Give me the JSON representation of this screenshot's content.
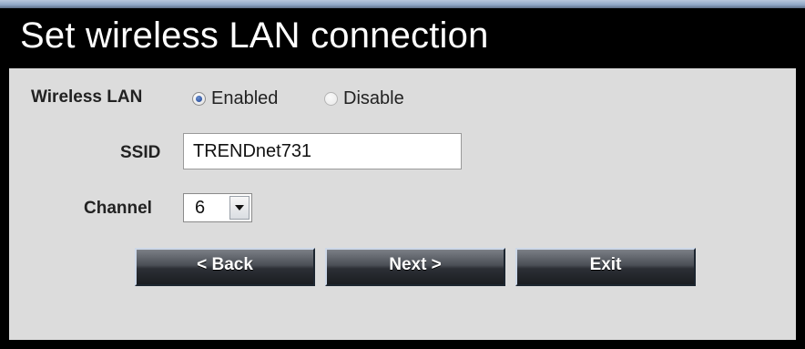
{
  "header": {
    "title": "Set wireless LAN connection"
  },
  "form": {
    "wireless_lan": {
      "label": "Wireless LAN",
      "options": [
        {
          "label": "Enabled",
          "selected": true
        },
        {
          "label": "Disable",
          "selected": false
        }
      ]
    },
    "ssid": {
      "label": "SSID",
      "value": "TRENDnet731"
    },
    "channel": {
      "label": "Channel",
      "value": "6"
    }
  },
  "buttons": {
    "back": "< Back",
    "next": "Next >",
    "exit": "Exit"
  },
  "colors": {
    "header_bg": "#000000",
    "panel_bg": "#dcdcdc",
    "button_bg": "#2c2f35",
    "button_text": "#ffffff"
  }
}
